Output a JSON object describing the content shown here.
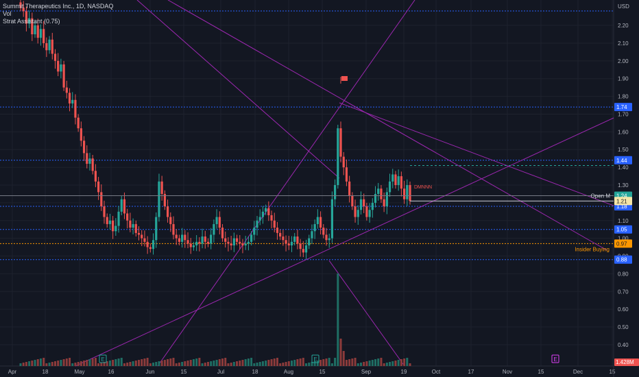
{
  "legend": {
    "symbol": "Summit Therapeutics Inc., 1D, NASDAQ",
    "vol": "Vol",
    "indicator": "Strat Assistant (0.75)"
  },
  "colors": {
    "background": "#131722",
    "up": "#26a69a",
    "down": "#ef5350",
    "trendline": "#9c27b0",
    "level": "#2962ff",
    "insider": "#ff9800",
    "grid": "#1e222d",
    "axis_text": "#b2b5be"
  },
  "chart_data": {
    "type": "candlestick",
    "title": "Summit Therapeutics Inc., 1D, NASDAQ",
    "ylabel": "USD",
    "ylim": [
      0.28,
      2.32
    ],
    "y_ticks": [
      "2.20",
      "2.10",
      "2.00",
      "1.90",
      "1.80",
      "1.70",
      "1.60",
      "1.50",
      "1.40",
      "1.30",
      "1.20",
      "1.10",
      "1.00",
      "0.90",
      "0.80",
      "0.70",
      "0.60",
      "0.50",
      "0.40"
    ],
    "x_ticks": [
      "Apr",
      "18",
      "May",
      "16",
      "Jun",
      "15",
      "Jul",
      "18",
      "Aug",
      "15",
      "Sep",
      "19",
      "Oct",
      "17",
      "Nov",
      "15",
      "Dec",
      "15"
    ],
    "closes": [
      2.3,
      2.28,
      2.21,
      2.24,
      2.15,
      2.2,
      2.13,
      2.18,
      2.1,
      2.06,
      2.12,
      2.04,
      2.0,
      1.94,
      1.98,
      1.85,
      1.82,
      1.76,
      1.78,
      1.68,
      1.62,
      1.55,
      1.48,
      1.42,
      1.45,
      1.38,
      1.32,
      1.26,
      1.18,
      1.12,
      1.08,
      1.1,
      1.04,
      1.07,
      1.15,
      1.22,
      1.14,
      1.1,
      1.06,
      1.08,
      1.03,
      1.02,
      1.0,
      0.98,
      0.95,
      0.94,
      0.99,
      1.12,
      1.32,
      1.25,
      1.18,
      1.12,
      1.08,
      1.02,
      1.0,
      0.98,
      1.02,
      0.99,
      0.97,
      0.95,
      0.96,
      0.98,
      0.97,
      1.01,
      0.98,
      0.97,
      1.02,
      1.08,
      1.12,
      1.06,
      1.0,
      0.98,
      0.97,
      0.96,
      1.0,
      0.98,
      0.97,
      0.96,
      0.97,
      0.98,
      1.02,
      1.06,
      1.1,
      1.12,
      1.15,
      1.17,
      1.13,
      1.1,
      1.06,
      1.03,
      1.01,
      0.99,
      0.97,
      0.96,
      0.98,
      1.01,
      0.97,
      0.94,
      0.92,
      0.96,
      1.0,
      1.04,
      1.08,
      1.12,
      1.06,
      1.02,
      0.99,
      1.0,
      1.22,
      1.3,
      1.62,
      1.46,
      1.4,
      1.32,
      1.24,
      1.18,
      1.12,
      1.16,
      1.22,
      1.18,
      1.12,
      1.16,
      1.2,
      1.25,
      1.28,
      1.22,
      1.18,
      1.26,
      1.32,
      1.36,
      1.3,
      1.35,
      1.28,
      1.22,
      1.3,
      1.21
    ],
    "volume_peak_label": "1.428M",
    "levels": [
      {
        "label": "1.74",
        "value": 1.74,
        "color": "#2962ff"
      },
      {
        "label": "1.44",
        "value": 1.44,
        "color": "#2962ff"
      },
      {
        "label": "1.18",
        "value": 1.18,
        "color": "#2962ff"
      },
      {
        "label": "1.05",
        "value": 1.05,
        "color": "#2962ff"
      },
      {
        "label": "0.88",
        "value": 0.88,
        "color": "#2962ff"
      },
      {
        "label": "0.97",
        "value": 0.97,
        "color": "#ff9800"
      }
    ],
    "price_tags": [
      {
        "label": "1.24",
        "value": 1.24,
        "color": "#26a69a"
      },
      {
        "label": "1.21",
        "value": 1.21,
        "color": "#f5e6a8"
      }
    ],
    "annotations": {
      "open_m": "Open M",
      "insider": "Insider Buying",
      "dm": "DMNNN",
      "usd": "USD",
      "events": [
        "E",
        "E",
        "E"
      ]
    }
  }
}
